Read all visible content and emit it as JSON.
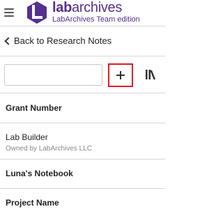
{
  "header": {
    "menu_icon": "hamburger-icon",
    "logo_icon": "labarchives-logo-icon",
    "brand_bold": "lab",
    "brand_light": "archives",
    "edition": "LabArchives Team edition",
    "brand_color": "#55308f"
  },
  "nav": {
    "back_label": "Back to Research Notes",
    "back_icon": "chevron-left-icon"
  },
  "search": {
    "value": "",
    "placeholder": "",
    "add_icon": "plus-icon",
    "add_highlight_color": "#e01b24",
    "library_icon": "library-icon"
  },
  "notebooks": [
    {
      "title": "Grant Number",
      "subtitle": "",
      "bold": true
    },
    {
      "title": "Lab Builder",
      "subtitle": "Owned by LabArchives LLC",
      "bold": false
    },
    {
      "title": "Luna's Notebook",
      "subtitle": "",
      "bold": true
    },
    {
      "title": "Project Name",
      "subtitle": "",
      "bold": true
    }
  ]
}
